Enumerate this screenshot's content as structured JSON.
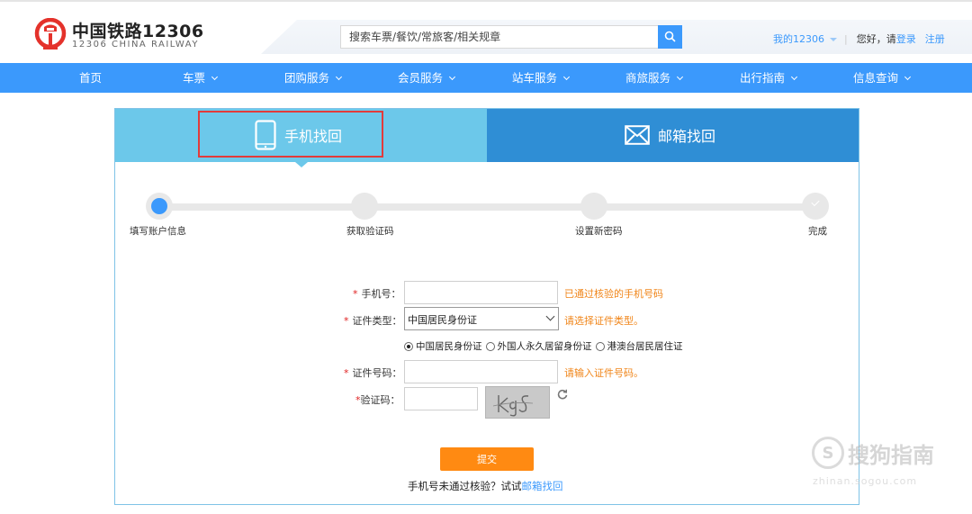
{
  "header": {
    "brand_cn": "中国铁路12306",
    "brand_en": "12306 CHINA RAILWAY",
    "search_placeholder": "搜索车票/餐饮/常旅客/相关规章",
    "my12306": "我的12306",
    "hello": "您好，请",
    "login": "登录",
    "register": "注册",
    "logo_icon": "railway-logo-icon",
    "accent_color": "#3b99fc"
  },
  "nav": {
    "items": [
      {
        "label": "首页"
      },
      {
        "label": "车票"
      },
      {
        "label": "团购服务"
      },
      {
        "label": "会员服务"
      },
      {
        "label": "站车服务"
      },
      {
        "label": "商旅服务"
      },
      {
        "label": "出行指南"
      },
      {
        "label": "信息查询"
      }
    ]
  },
  "tabs": {
    "phone": "手机找回",
    "email": "邮箱找回"
  },
  "steps": [
    "填写账户信息",
    "获取验证码",
    "设置新密码",
    "完成"
  ],
  "form": {
    "phone_label": "手机号：",
    "phone_hint": "已通过核验的手机号码",
    "id_type_label": "证件类型：",
    "id_type_value": "中国居民身份证",
    "id_type_hint": "请选择证件类型。",
    "radio_options": [
      "中国居民身份证",
      "外国人永久居留身份证",
      "港澳台居民居住证"
    ],
    "id_number_label": "证件号码：",
    "id_number_hint": "请输入证件号码。",
    "captcha_label": "验证码：",
    "captcha_text": "kgS",
    "submit": "提交",
    "note_prefix": "手机号未通过核验？试试",
    "note_link": "邮箱找回"
  },
  "watermark": {
    "text": "搜狗指南",
    "sub": "zhinan.sogou.com"
  }
}
